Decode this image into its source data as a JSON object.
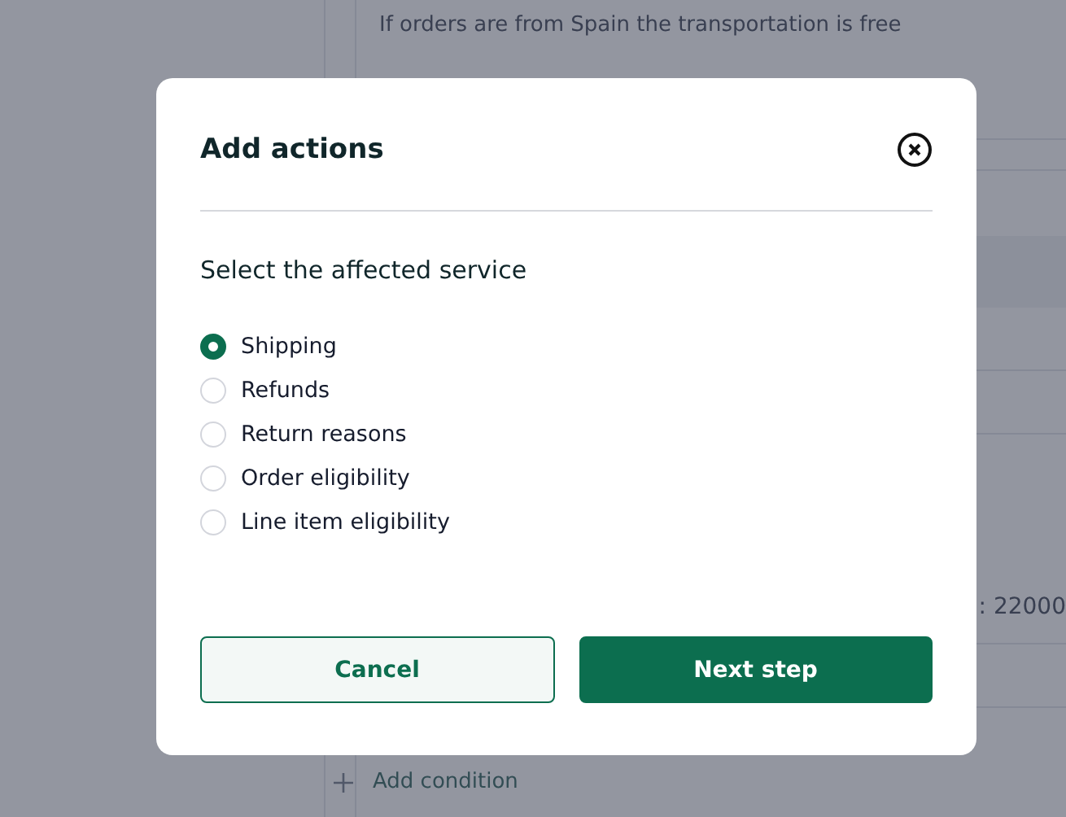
{
  "background": {
    "rule_text": "If orders are from Spain the transportation is free",
    "value_fragment": ": 22000",
    "add_condition": "Add condition"
  },
  "dialog": {
    "title": "Add actions",
    "subtitle": "Select the affected service",
    "options": [
      {
        "label": "Shipping",
        "selected": true
      },
      {
        "label": "Refunds",
        "selected": false
      },
      {
        "label": "Return reasons",
        "selected": false
      },
      {
        "label": "Order eligibility",
        "selected": false
      },
      {
        "label": "Line item eligibility",
        "selected": false
      }
    ],
    "buttons": [
      {
        "label": "Cancel",
        "kind": "secondary"
      },
      {
        "label": "Next step",
        "kind": "primary"
      }
    ]
  }
}
